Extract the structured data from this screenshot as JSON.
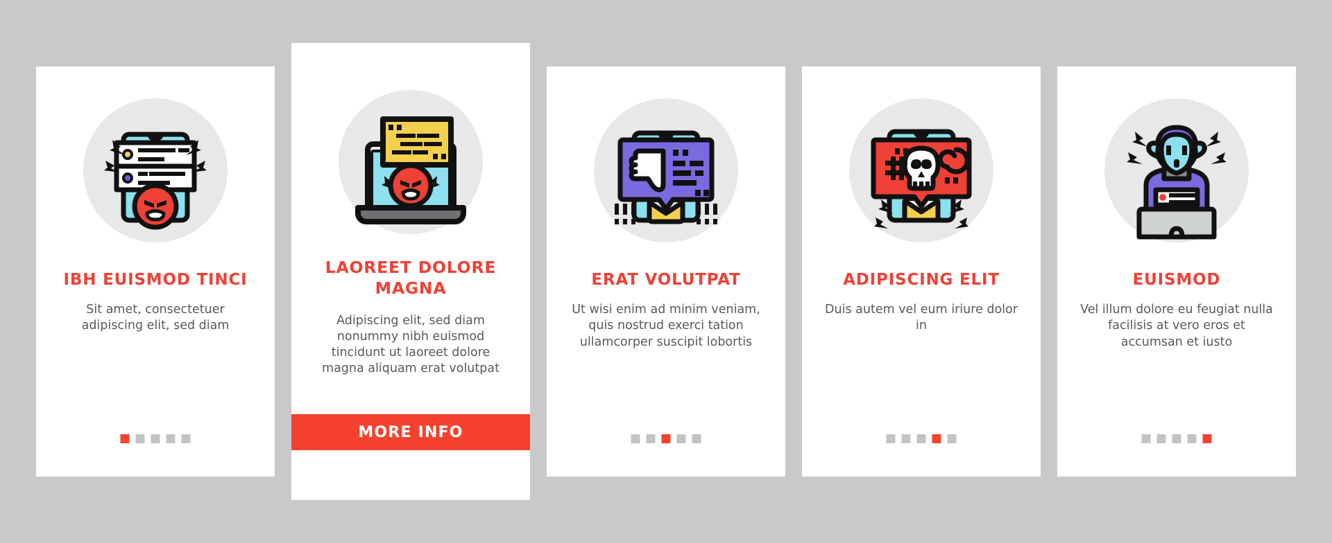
{
  "page": {
    "background_color": "#c9c9c9",
    "card_background": "#ffffff",
    "accent_color": "#ef4136",
    "cta_color": "#f5422e",
    "body_text_color": "#58595b",
    "dot_inactive_color": "#c3c3c3",
    "icon_circle_color": "#e8e8e8"
  },
  "cards": [
    {
      "icon_name": "phone-angry-messages-icon",
      "title": "IBH EUISMOD TINCI",
      "body": "Sit amet, consectetuer adipiscing elit, sed diam",
      "dots_total": 5,
      "dot_active_index": 0,
      "featured": false
    },
    {
      "icon_name": "laptop-angry-message-icon",
      "title": "LAOREET DOLORE MAGNA",
      "body": "Adipiscing elit, sed diam nonummy nibh euismod tincidunt ut laoreet dolore magna aliquam erat volutpat",
      "cta_label": "MORE INFO",
      "dots_total": 5,
      "dot_active_index": 1,
      "featured": true
    },
    {
      "icon_name": "phone-thumbs-down-comment-icon",
      "title": "ERAT VOLUTPAT",
      "body": "Ut wisi enim ad minim veniam, quis nostrud exerci tation ullamcorper suscipit lobortis",
      "dots_total": 5,
      "dot_active_index": 2,
      "featured": false
    },
    {
      "icon_name": "phone-skull-threat-icon",
      "title": "ADIPISCING ELIT",
      "body": "Duis autem vel eum iriure dolor in",
      "dots_total": 5,
      "dot_active_index": 3,
      "featured": false
    },
    {
      "icon_name": "troll-hacker-laptop-icon",
      "title": "EUISMOD",
      "body": "Vel illum dolore eu feugiat nulla facilisis at vero eros et accumsan et iusto",
      "dots_total": 5,
      "dot_active_index": 4,
      "featured": false
    }
  ]
}
